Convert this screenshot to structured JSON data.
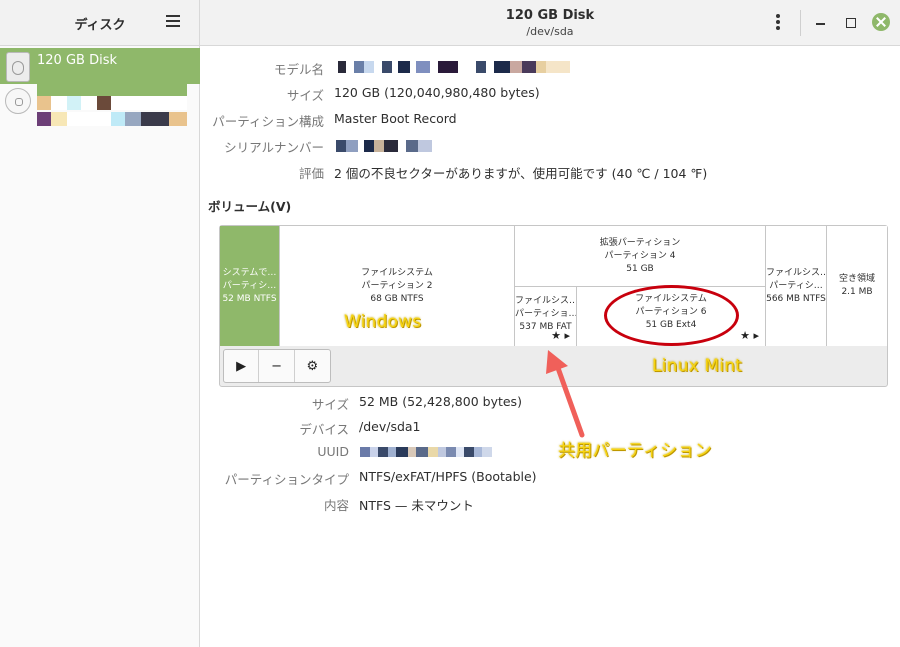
{
  "sidebar": {
    "header": "ディスク",
    "items": [
      {
        "label": "120 GB Disk"
      }
    ]
  },
  "header": {
    "title": "120 GB Disk",
    "subtitle": "/dev/sda"
  },
  "disk_info": [
    {
      "label": "モデル名",
      "value": ""
    },
    {
      "label": "サイズ",
      "value": "120 GB (120,040,980,480 bytes)"
    },
    {
      "label": "パーティション構成",
      "value": "Master Boot Record"
    },
    {
      "label": "シリアルナンバー",
      "value": ""
    },
    {
      "label": "評価",
      "value": "2 個の不良セクターがありますが、使用可能です (40 ℃ / 104 ℉)"
    }
  ],
  "volumes": {
    "title": "ボリューム(V)",
    "segments": {
      "p1": [
        "システムで…",
        "パーティシ…",
        "52 MB NTFS"
      ],
      "p2": [
        "ファイルシステム",
        "パーティション 2",
        "68 GB NTFS"
      ],
      "ext": [
        "拡張パーティション",
        "パーティション 4",
        "51 GB"
      ],
      "p5": [
        "ファイルシス…",
        "パーティショ…",
        "537 MB FAT"
      ],
      "p6": [
        "ファイルシステム",
        "パーティション 6",
        "51 GB Ext4"
      ],
      "p3": [
        "ファイルシス…",
        "パーティシ…",
        "566 MB NTFS"
      ],
      "free": [
        "空き領域",
        "2.1 MB"
      ]
    }
  },
  "partition_info": [
    {
      "label": "サイズ",
      "value": "52 MB (52,428,800 bytes)"
    },
    {
      "label": "デバイス",
      "value": "/dev/sda1"
    },
    {
      "label": "UUID",
      "value": ""
    },
    {
      "label": "パーティションタイプ",
      "value": "NTFS/exFAT/HPFS (Bootable)"
    },
    {
      "label": "内容",
      "value": "NTFS — 未マウント"
    }
  ],
  "annotations": {
    "windows": "Windows",
    "linux": "Linux Mint",
    "shared": "共用パーティション"
  },
  "colors": {
    "accent": "#8fb86a",
    "annotation_text": "#f7d414",
    "annotation_ellipse": "#c8000d",
    "annotation_arrow": "#f0605a"
  }
}
